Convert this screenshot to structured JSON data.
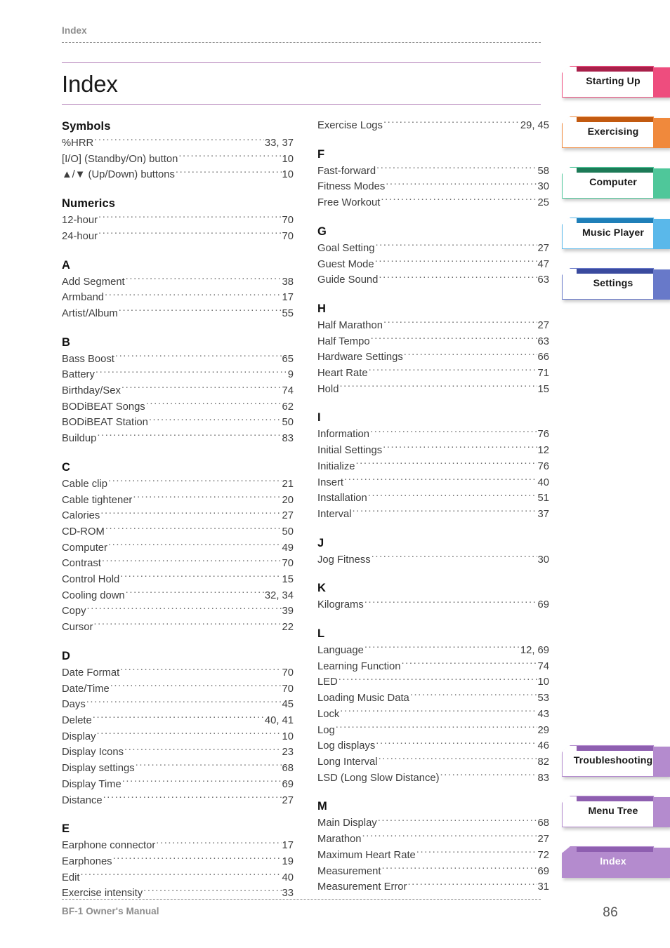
{
  "header": {
    "running_head": "Index"
  },
  "title": {
    "text": "Index"
  },
  "footer": {
    "manual_name": "BF-1 Owner's Manual",
    "page_number": "86"
  },
  "index": {
    "left_column": [
      {
        "heading": "Symbols",
        "entries": [
          {
            "label": "%HRR",
            "page": "33, 37"
          },
          {
            "label": "[I/O] (Standby/On) button",
            "page": "10"
          },
          {
            "label": "▲/▼ (Up/Down) buttons",
            "page": "10"
          }
        ]
      },
      {
        "heading": "Numerics",
        "entries": [
          {
            "label": "12-hour",
            "page": "70"
          },
          {
            "label": "24-hour",
            "page": "70"
          }
        ]
      },
      {
        "heading": "A",
        "entries": [
          {
            "label": "Add Segment",
            "page": "38"
          },
          {
            "label": "Armband",
            "page": "17"
          },
          {
            "label": "Artist/Album",
            "page": "55"
          }
        ]
      },
      {
        "heading": "B",
        "entries": [
          {
            "label": "Bass Boost",
            "page": "65"
          },
          {
            "label": "Battery",
            "page": "9"
          },
          {
            "label": "Birthday/Sex",
            "page": "74"
          },
          {
            "label": "BODiBEAT Songs",
            "page": "62"
          },
          {
            "label": "BODiBEAT Station",
            "page": "50"
          },
          {
            "label": "Buildup",
            "page": "83"
          }
        ]
      },
      {
        "heading": "C",
        "entries": [
          {
            "label": "Cable clip",
            "page": "21"
          },
          {
            "label": "Cable tightener",
            "page": "20"
          },
          {
            "label": "Calories",
            "page": "27"
          },
          {
            "label": "CD-ROM",
            "page": "50"
          },
          {
            "label": "Computer",
            "page": "49"
          },
          {
            "label": "Contrast",
            "page": "70"
          },
          {
            "label": "Control Hold",
            "page": "15"
          },
          {
            "label": "Cooling down",
            "page": "32, 34"
          },
          {
            "label": "Copy",
            "page": "39"
          },
          {
            "label": "Cursor",
            "page": "22"
          }
        ]
      },
      {
        "heading": "D",
        "entries": [
          {
            "label": "Date Format",
            "page": "70"
          },
          {
            "label": "Date/Time",
            "page": "70"
          },
          {
            "label": "Days",
            "page": "45"
          },
          {
            "label": "Delete",
            "page": "40, 41"
          },
          {
            "label": "Display",
            "page": "10"
          },
          {
            "label": "Display Icons",
            "page": "23"
          },
          {
            "label": "Display settings",
            "page": "68"
          },
          {
            "label": "Display Time",
            "page": "69"
          },
          {
            "label": "Distance",
            "page": "27"
          }
        ]
      },
      {
        "heading": "E",
        "entries": [
          {
            "label": "Earphone connector",
            "page": "17"
          },
          {
            "label": "Earphones",
            "page": "19"
          },
          {
            "label": "Edit",
            "page": "40"
          },
          {
            "label": "Exercise intensity",
            "page": "33"
          }
        ]
      }
    ],
    "right_column": [
      {
        "heading": "",
        "entries": [
          {
            "label": "Exercise Logs",
            "page": "29, 45"
          }
        ]
      },
      {
        "heading": "F",
        "entries": [
          {
            "label": "Fast-forward",
            "page": "58"
          },
          {
            "label": "Fitness Modes",
            "page": "30"
          },
          {
            "label": "Free Workout",
            "page": "25"
          }
        ]
      },
      {
        "heading": "G",
        "entries": [
          {
            "label": "Goal Setting",
            "page": "27"
          },
          {
            "label": "Guest Mode",
            "page": "47"
          },
          {
            "label": "Guide Sound",
            "page": "63"
          }
        ]
      },
      {
        "heading": "H",
        "entries": [
          {
            "label": "Half Marathon",
            "page": "27"
          },
          {
            "label": "Half Tempo",
            "page": "63"
          },
          {
            "label": "Hardware Settings",
            "page": "66"
          },
          {
            "label": "Heart Rate",
            "page": "71"
          },
          {
            "label": "Hold",
            "page": "15"
          }
        ]
      },
      {
        "heading": "I",
        "entries": [
          {
            "label": "Information",
            "page": "76"
          },
          {
            "label": "Initial Settings",
            "page": "12"
          },
          {
            "label": "Initialize",
            "page": "76"
          },
          {
            "label": "Insert",
            "page": "40"
          },
          {
            "label": "Installation",
            "page": "51"
          },
          {
            "label": "Interval",
            "page": "37"
          }
        ]
      },
      {
        "heading": "J",
        "entries": [
          {
            "label": "Jog Fitness",
            "page": "30"
          }
        ]
      },
      {
        "heading": "K",
        "entries": [
          {
            "label": "Kilograms",
            "page": "69"
          }
        ]
      },
      {
        "heading": "L",
        "entries": [
          {
            "label": "Language",
            "page": "12, 69"
          },
          {
            "label": "Learning Function",
            "page": "74"
          },
          {
            "label": "LED",
            "page": "10"
          },
          {
            "label": "Loading Music Data",
            "page": "53"
          },
          {
            "label": "Lock",
            "page": "43"
          },
          {
            "label": "Log",
            "page": "29"
          },
          {
            "label": "Log displays",
            "page": "46"
          },
          {
            "label": "Long Interval",
            "page": "82"
          },
          {
            "label": "LSD (Long Slow Distance)",
            "page": "83"
          }
        ]
      },
      {
        "heading": "M",
        "entries": [
          {
            "label": "Main Display",
            "page": "68"
          },
          {
            "label": "Marathon",
            "page": "27"
          },
          {
            "label": "Maximum Heart Rate",
            "page": "72"
          },
          {
            "label": "Measurement",
            "page": "69"
          },
          {
            "label": "Measurement Error",
            "page": "31"
          }
        ]
      }
    ]
  },
  "tabs_top": [
    {
      "label": "Starting Up",
      "color": "#ee4d7e",
      "bar_color": "#a8204a",
      "active": false
    },
    {
      "label": "Exercising",
      "color": "#f0893c",
      "bar_color": "#c25a10",
      "active": false
    },
    {
      "label": "Computer",
      "color": "#4fc79a",
      "bar_color": "#1d7a57",
      "active": false
    },
    {
      "label": "Music Player",
      "color": "#5ab8ea",
      "bar_color": "#1f7fb8",
      "active": false
    },
    {
      "label": "Settings",
      "color": "#6879c9",
      "bar_color": "#3a4a9e",
      "active": false
    }
  ],
  "tabs_bottom": [
    {
      "label": "Troubleshooting",
      "color": "#b48bce",
      "bar_color": "#8e5fb0",
      "active": false
    },
    {
      "label": "Menu Tree",
      "color": "#b48bce",
      "bar_color": "#8e5fb0",
      "active": false
    },
    {
      "label": "Index",
      "color": "#b48bce",
      "bar_color": "#8e5fb0",
      "active": true
    }
  ],
  "theme": {
    "rule_color": "#b07cb5",
    "muted_text": "#8c8c8c"
  }
}
